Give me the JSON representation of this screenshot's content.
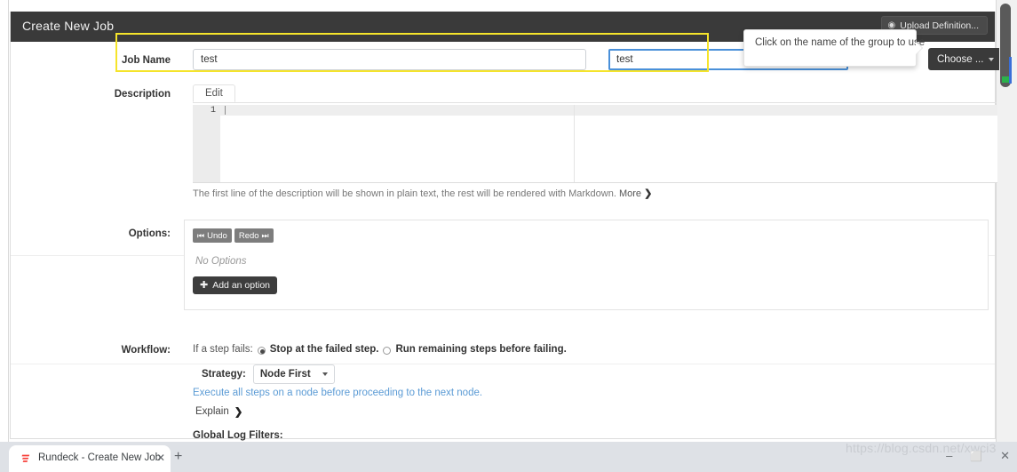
{
  "browser": {
    "tab_title": "Rundeck - Create New Job",
    "favicon_name": "rundeck-logo-icon",
    "close_tab_glyph": "✕",
    "new_tab_glyph": "+",
    "watermark": "https://blog.csdn.net/xwci3",
    "window_minimize": "–",
    "window_maximize": "⬜",
    "window_close": "✕"
  },
  "panel": {
    "title": "Create New Job",
    "upload_button": {
      "label": "Upload Definition...",
      "icon": "◉"
    }
  },
  "form": {
    "job_name": {
      "label": "Job Name",
      "value": "test",
      "placeholder": ""
    },
    "group_name": {
      "value": "test",
      "placeholder": ""
    },
    "choose_button": {
      "label": "Choose ..."
    },
    "group_popover": {
      "text": "Click on the name of the group to use"
    },
    "description": {
      "label": "Description",
      "tab_edit": "Edit",
      "line_number": "1",
      "content": "",
      "help_text": "The first line of the description will be shown in plain text, the rest will be rendered with Markdown.",
      "help_more": "More",
      "help_chevron": "❯"
    },
    "options": {
      "label": "Options:",
      "undo": {
        "label": "Undo",
        "icon": "⏮"
      },
      "redo": {
        "label": "Redo",
        "icon": "⏭"
      },
      "empty_text": "No Options",
      "add_button": {
        "label": "Add an option",
        "icon": "✚"
      }
    },
    "workflow": {
      "label": "Workflow:",
      "if_step_fails_label": "If a step fails:",
      "radio_options": [
        {
          "label": "Stop at the failed step.",
          "selected": true
        },
        {
          "label": "Run remaining steps before failing.",
          "selected": false
        }
      ],
      "strategy_label": "Strategy:",
      "strategy_value": "Node First",
      "strategy_description": "Execute all steps on a node before proceeding to the next node.",
      "explain_label": "Explain",
      "explain_chevron": "❯",
      "global_log_filters_label": "Global Log Filters:"
    }
  },
  "colors": {
    "header_bg": "#3a3a3a",
    "highlight": "#f5e42b",
    "focus_border": "#4a90d9",
    "link_blue": "#5b9bd5",
    "dark_button": "#3d3d3d"
  }
}
